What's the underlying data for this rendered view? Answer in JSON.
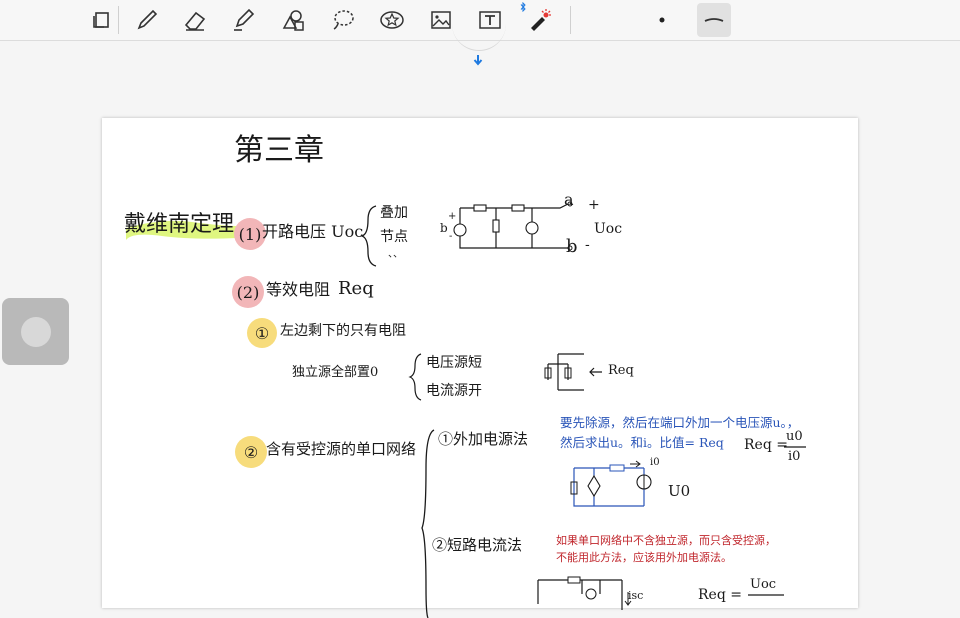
{
  "toolbar": {
    "tools": [
      "page-layout",
      "pen",
      "eraser",
      "highlighter",
      "shapes",
      "lasso",
      "sticker",
      "image",
      "text",
      "laser-pointer",
      "pen-size-small",
      "pen-stroke-style"
    ],
    "accent": "#1f7ae0"
  },
  "notebook": {
    "chapter_title": "第三章",
    "theorem_title": "戴维南定理",
    "step1": {
      "number": "(1)",
      "label": "开路电压 Uoc",
      "methods": [
        "叠加",
        "节点",
        "、、"
      ],
      "terminal_a": "a",
      "terminal_b": "b",
      "plus": "+",
      "minus": "-",
      "voc_label": "Uoc",
      "source_label": "b",
      "source_plus": "+",
      "source_minus": "-"
    },
    "step2": {
      "number": "(2)",
      "label": "等效电阻",
      "symbol": "Req",
      "case1": {
        "number": "①",
        "label": "左边剩下的只有电阻",
        "rule": "独立源全部置0",
        "voltage_rule": "电压源短",
        "current_rule": "电流源开",
        "req_label": "Req"
      },
      "case2": {
        "number": "②",
        "label": "含有受控源的单口网络",
        "method1": "①外加电源法",
        "note_line1": "要先除源，然后在端口外加一个电压源u。，",
        "note_line2": "然后求出u。和i。比值= Req",
        "formula_lhs": "Req =",
        "formula_num": "u0",
        "formula_den": "i0",
        "i0_label": "i0",
        "u0_label": "U0",
        "method2": "②短路电流法",
        "red_line1": "如果单口网络中不含独立源，而只含受控源，",
        "red_line2": "不能用此方法，应该用外加电源法。",
        "formula2_lhs": "Req =",
        "formula2_num": "Uoc",
        "isc_label": "isc"
      }
    },
    "colors": {
      "highlight_green": "#d9f56a",
      "circle_red": "#f2b6b8",
      "circle_yellow": "#f7dc7c",
      "note_blue": "#2a55b8",
      "note_red": "#c0262c"
    }
  }
}
